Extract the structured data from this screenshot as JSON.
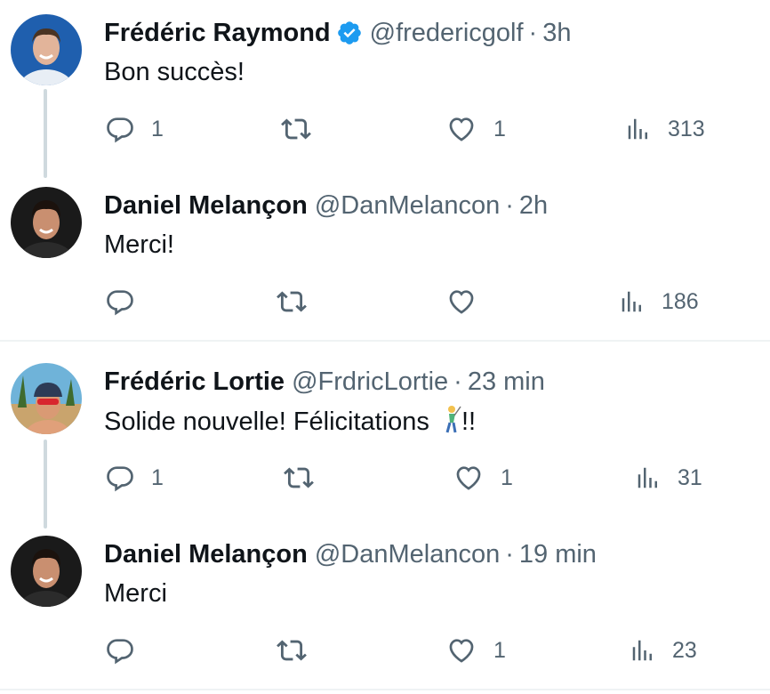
{
  "tweets": [
    {
      "name": "Frédéric Raymond",
      "verified": true,
      "handle": "@fredericgolf",
      "time": "3h",
      "text": "Bon succès!",
      "replies": "1",
      "retweets": "",
      "likes": "1",
      "views": "313"
    },
    {
      "name": "Daniel Melançon",
      "verified": false,
      "handle": "@DanMelancon",
      "time": "2h",
      "text": "Merci!",
      "replies": "",
      "retweets": "",
      "likes": "",
      "views": "186"
    },
    {
      "name": "Frédéric Lortie",
      "verified": false,
      "handle": "@FrdricLortie",
      "time": "23 min",
      "text": "Solide nouvelle! Félicitations",
      "text_suffix": "!!",
      "emoji": "golfer",
      "replies": "1",
      "retweets": "",
      "likes": "1",
      "views": "31"
    },
    {
      "name": "Daniel Melançon",
      "verified": false,
      "handle": "@DanMelancon",
      "time": "19 min",
      "text": "Merci",
      "replies": "",
      "retweets": "",
      "likes": "1",
      "views": "23"
    }
  ],
  "separator": "·",
  "colors": {
    "text": "#0f1419",
    "secondary": "#536471",
    "verified": "#1d9bf0",
    "thread_line": "#cfd9de",
    "divider": "#eff3f4"
  }
}
